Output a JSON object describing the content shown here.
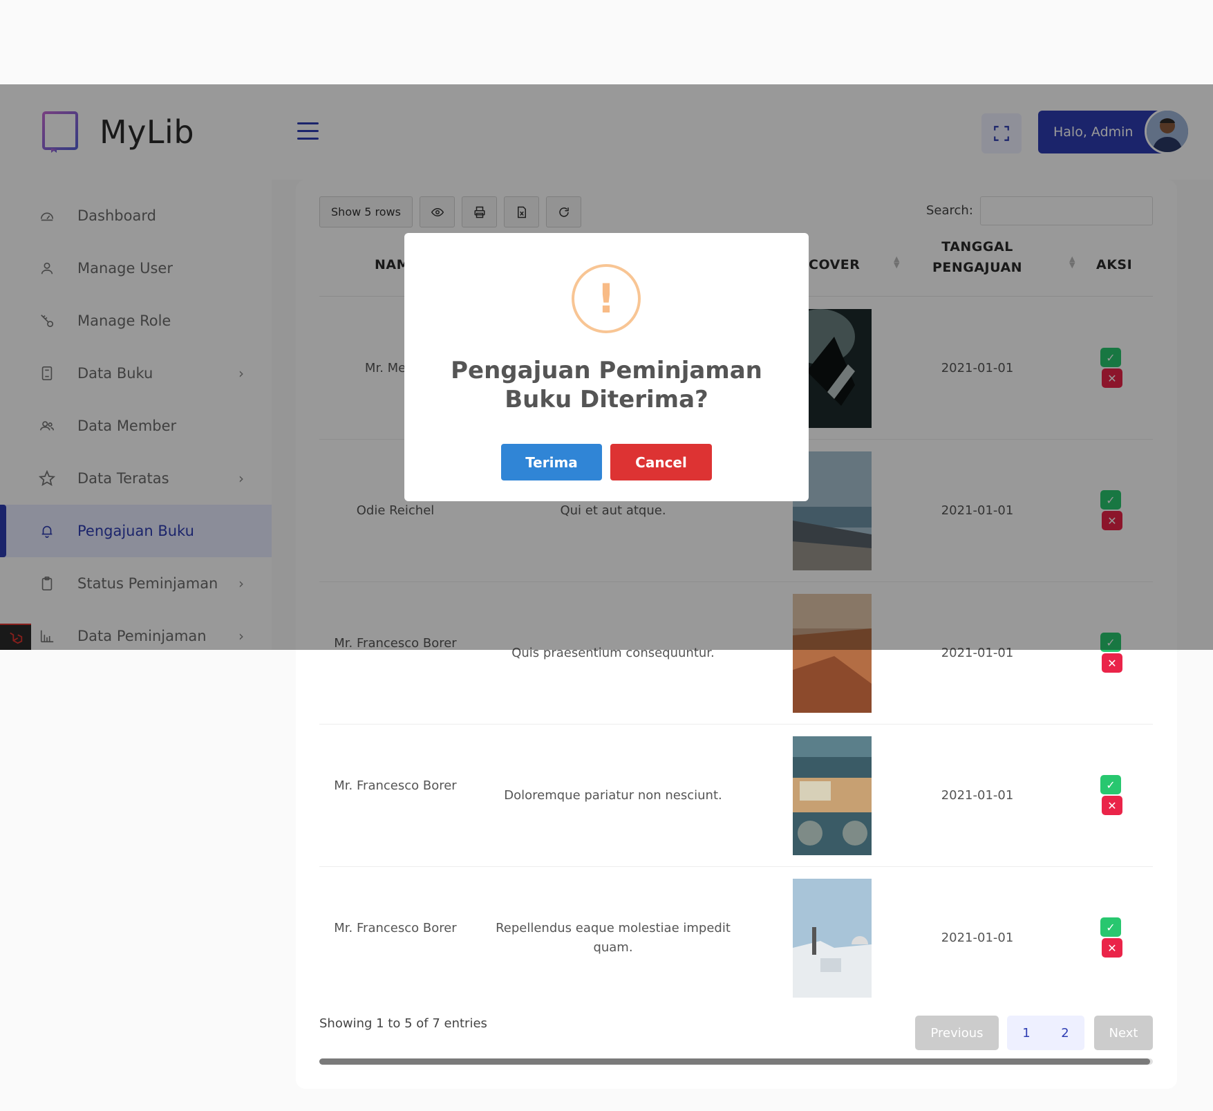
{
  "app": {
    "name": "MyLib"
  },
  "sidebar": {
    "items": [
      {
        "label": "Dashboard",
        "icon": "dashboard-icon",
        "chevron": false
      },
      {
        "label": "Manage User",
        "icon": "user-icon",
        "chevron": false
      },
      {
        "label": "Manage Role",
        "icon": "key-icon",
        "chevron": false
      },
      {
        "label": "Data Buku",
        "icon": "book-icon",
        "chevron": true
      },
      {
        "label": "Data Member",
        "icon": "users-icon",
        "chevron": false
      },
      {
        "label": "Data Teratas",
        "icon": "star-icon",
        "chevron": true
      },
      {
        "label": "Pengajuan Buku",
        "icon": "bell-icon",
        "chevron": false,
        "active": true
      },
      {
        "label": "Status Peminjaman",
        "icon": "clipboard-icon",
        "chevron": true
      },
      {
        "label": "Data Peminjaman",
        "icon": "bar-chart-icon",
        "chevron": true
      }
    ]
  },
  "header": {
    "admin_label": "Halo, Admin"
  },
  "toolbar": {
    "rows_label": "Show 5 rows",
    "search_label": "Search:",
    "search_value": ""
  },
  "table": {
    "headers": {
      "nama": "NAMA",
      "cover": "COVER",
      "tanggal": "TANGGAL PENGAJUAN",
      "aksi": "AKSI"
    },
    "rows": [
      {
        "nama": "Mr. Merlin",
        "judul": "",
        "tanggal": "2021-01-01"
      },
      {
        "nama": "Odie Reichel",
        "judul": "Qui et aut atque.",
        "tanggal": "2021-01-01"
      },
      {
        "nama": "Mr. Francesco Borer",
        "judul": "Quis praesentium consequuntur.",
        "tanggal": "2021-01-01"
      },
      {
        "nama": "Mr. Francesco Borer",
        "judul": "Doloremque pariatur non nesciunt.",
        "tanggal": "2021-01-01"
      },
      {
        "nama": "Mr. Francesco Borer",
        "judul": "Repellendus eaque molestiae impedit quam.",
        "tanggal": "2021-01-01"
      }
    ],
    "info": "Showing 1 to 5 of 7 entries",
    "pagination": {
      "previous": "Previous",
      "page1": "1",
      "page2": "2",
      "next": "Next"
    }
  },
  "modal": {
    "icon": "exclamation-icon",
    "title": "Pengajuan Peminjaman Buku Diterima?",
    "confirm_label": "Terima",
    "cancel_label": "Cancel"
  },
  "colors": {
    "primary": "#2e3db3",
    "success": "#28c76f",
    "danger": "#ea2449",
    "confirm": "#3085d6",
    "cancel": "#dd3333",
    "warning": "#f8bb86"
  }
}
